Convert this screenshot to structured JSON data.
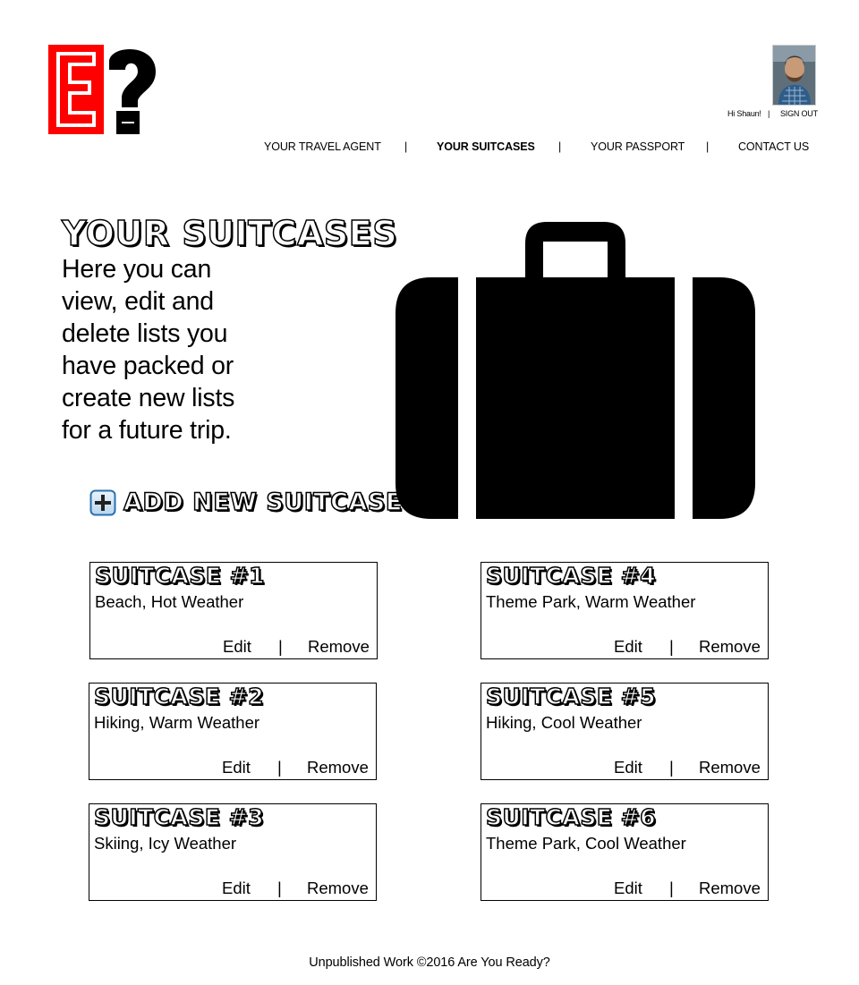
{
  "logo": {
    "letters": "E?",
    "colors": {
      "primary": "#ff0000",
      "secondary": "#000000"
    }
  },
  "account": {
    "avatar_icon": "user-avatar",
    "greeting": "Hi Shaun!",
    "separator": "|",
    "sign_out": "SIGN OUT"
  },
  "nav": {
    "items": [
      {
        "label": "YOUR TRAVEL AGENT",
        "active": false
      },
      {
        "label": "YOUR SUITCASES",
        "active": true
      },
      {
        "label": "YOUR PASSPORT",
        "active": false
      },
      {
        "label": "CONTACT US",
        "active": false
      }
    ],
    "separator": "|"
  },
  "main": {
    "title": "YOUR SUITCASES",
    "intro_lines": [
      "Here you can",
      "view, edit and",
      "delete lists you",
      "have packed or",
      "create new lists",
      "for a future trip."
    ],
    "add_button": {
      "label": "ADD NEW SUITCASE",
      "icon": "plus-square-icon"
    },
    "hero_icon": "suitcase-icon"
  },
  "suitcases": [
    {
      "title": "SUITCASE #1",
      "description": "Beach, Hot Weather"
    },
    {
      "title": "SUITCASE #2",
      "description": "Hiking, Warm Weather"
    },
    {
      "title": "SUITCASE #3",
      "description": "Skiing, Icy Weather"
    },
    {
      "title": "SUITCASE #4",
      "description": "Theme Park, Warm Weather"
    },
    {
      "title": "SUITCASE #5",
      "description": "Hiking, Cool Weather"
    },
    {
      "title": "SUITCASE #6",
      "description": "Theme Park, Cool Weather"
    }
  ],
  "card_actions": {
    "edit": "Edit",
    "separator": "|",
    "remove": "Remove"
  },
  "footer": {
    "text": "Unpublished Work ©2016 Are You Ready?"
  }
}
